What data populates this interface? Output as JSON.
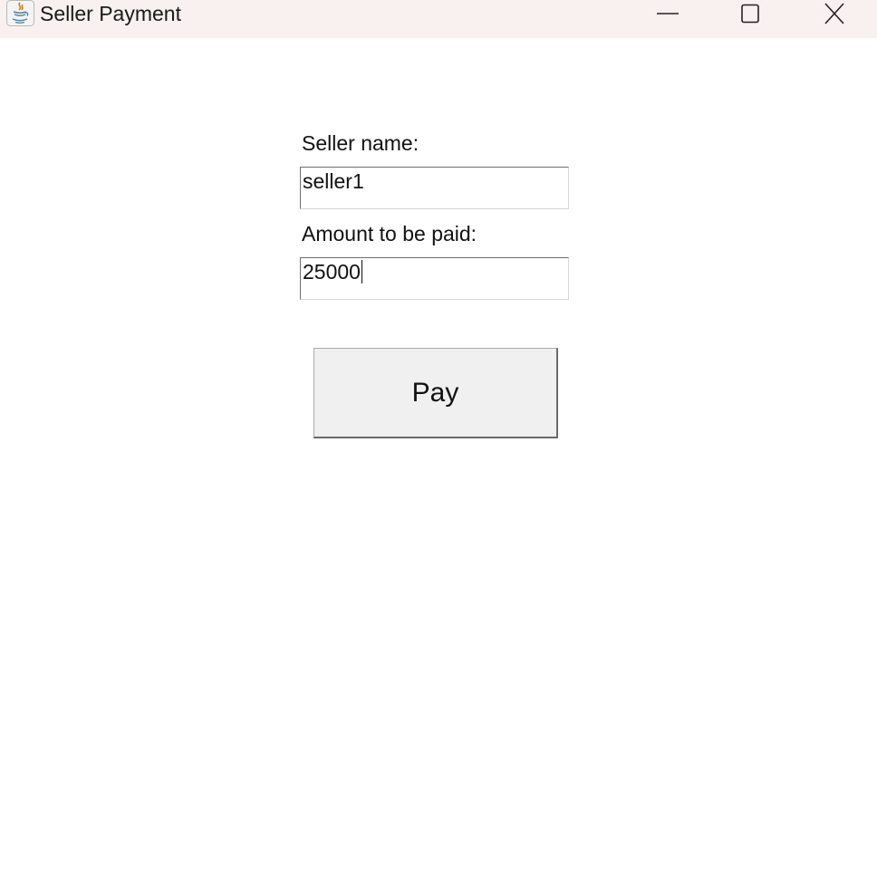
{
  "window": {
    "title": "Seller Payment",
    "icon": "java-cup-icon",
    "controls": {
      "minimize": "minimize-icon",
      "maximize": "maximize-icon",
      "close": "close-icon"
    }
  },
  "form": {
    "seller_label": "Seller name:",
    "seller_value": "seller1",
    "amount_label": "Amount to be paid:",
    "amount_value": "25000",
    "pay_label": "Pay"
  },
  "colors": {
    "titlebar_bg": "#f9f0f0",
    "button_bg": "#f0f0f0",
    "java_cup_orange": "#e76f00",
    "java_cup_blue": "#5382a1"
  }
}
